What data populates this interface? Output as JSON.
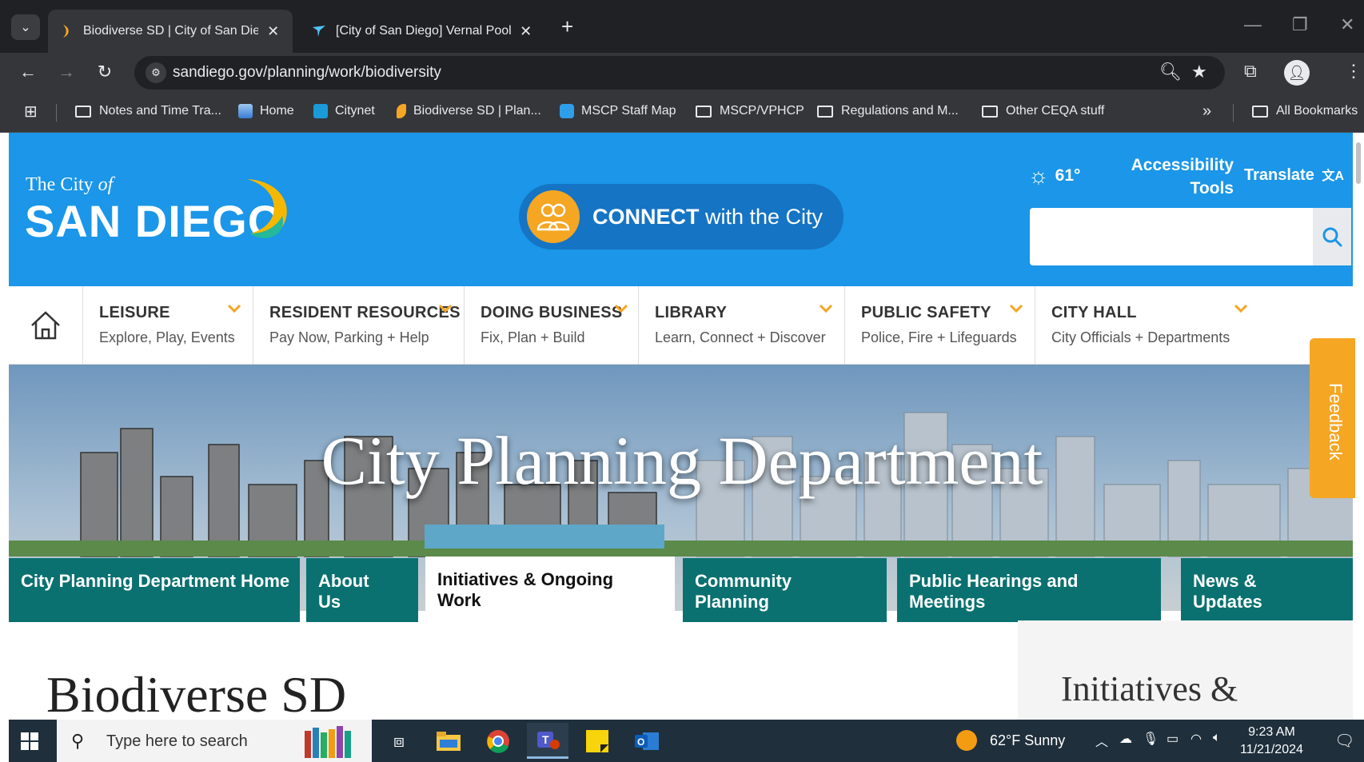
{
  "browser": {
    "tabs": [
      {
        "title": "Biodiverse SD | City of San Dieg",
        "active": true
      },
      {
        "title": "[City of San Diego] Vernal Pool",
        "active": false
      }
    ],
    "new_tab": "+",
    "url": "sandiego.gov/planning/work/biodiversity",
    "bookmarks": [
      {
        "label": "Notes and Time Tra...",
        "type": "folder"
      },
      {
        "label": "Home",
        "type": "page"
      },
      {
        "label": "Citynet",
        "type": "page"
      },
      {
        "label": "Biodiverse SD | Plan...",
        "type": "page"
      },
      {
        "label": "MSCP Staff Map",
        "type": "page"
      },
      {
        "label": "MSCP/VPHCP",
        "type": "folder"
      },
      {
        "label": "Regulations and M...",
        "type": "folder"
      },
      {
        "label": "Other CEQA stuff",
        "type": "folder"
      }
    ],
    "more": "»",
    "all_bookmarks": "All Bookmarks"
  },
  "site": {
    "logo_top": "The City",
    "logo_of": "of",
    "logo_main": "SAN DIEGO",
    "connect_bold": "CONNECT",
    "connect_rest": " with the City",
    "weather": "61°",
    "accessibility_line1": "Accessibility",
    "accessibility_line2": "Tools",
    "translate": "Translate",
    "translate_icon": "文A",
    "nav": [
      {
        "title": "LEISURE",
        "sub": "Explore, Play, Events"
      },
      {
        "title": "RESIDENT RESOURCES",
        "sub": "Pay Now, Parking + Help"
      },
      {
        "title": "DOING BUSINESS",
        "sub": "Fix, Plan + Build"
      },
      {
        "title": "LIBRARY",
        "sub": "Learn, Connect + Discover"
      },
      {
        "title": "PUBLIC SAFETY",
        "sub": "Police, Fire + Lifeguards"
      },
      {
        "title": "CITY HALL",
        "sub": "City Officials + Departments"
      }
    ],
    "hero_title": "City Planning Department",
    "feedback": "Feedback",
    "subnav": [
      {
        "label": "City Planning Department Home",
        "active": false
      },
      {
        "label": "About Us",
        "active": false
      },
      {
        "label": "Initiatives & Ongoing Work",
        "active": true
      },
      {
        "label": "Community Planning",
        "active": false
      },
      {
        "label": "Public Hearings and Meetings",
        "active": false
      },
      {
        "label": "News & Updates",
        "active": false
      }
    ],
    "page_heading": "Biodiverse SD",
    "aside_heading": "Initiatives &"
  },
  "taskbar": {
    "search_placeholder": "Type here to search",
    "weather": "62°F  Sunny",
    "time": "9:23 AM",
    "date": "11/21/2024"
  },
  "colors": {
    "header_blue": "#1b96e8",
    "connect_orange": "#f5a623",
    "subnav_teal": "#0a7170"
  }
}
